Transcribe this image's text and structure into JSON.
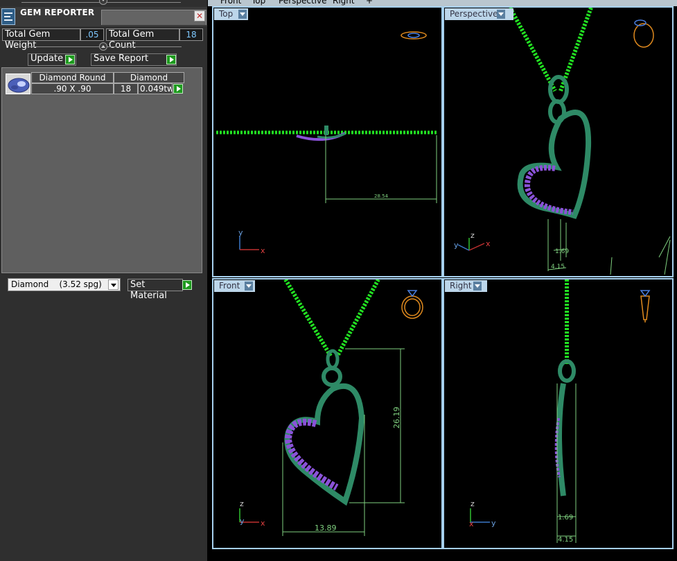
{
  "panel": {
    "title": "GEM REPORTER",
    "close_glyph": "✕",
    "total_gem_weight_label": "Total Gem Weight",
    "total_gem_weight_value": ".05",
    "total_gem_count_label": "Total Gem Count",
    "total_gem_count_value": "18",
    "update_label": "Update",
    "save_report_label": "Save Report",
    "gem_row": {
      "shape_header": "Diamond Round",
      "material_header": "Diamond",
      "size": ".90 X .90",
      "count": "18",
      "weight": "0.049tw"
    },
    "material_select_value": "Diamond    (3.52 spg)",
    "set_material_label": "Set Material"
  },
  "tabs": [
    "Front",
    "Top",
    "Perspective",
    "Right",
    "+"
  ],
  "viewports": {
    "top": {
      "label": "Top",
      "dimension": "28.54",
      "axes": [
        "y",
        "x"
      ]
    },
    "perspective": {
      "label": "Perspective",
      "dimensions": [
        "1.69",
        "4.15"
      ],
      "axes": [
        "z",
        "y",
        "x"
      ]
    },
    "front": {
      "label": "Front",
      "dimensions": [
        "26.19",
        "13.89"
      ],
      "axes": [
        "z",
        "y",
        "x"
      ]
    },
    "right": {
      "label": "Right",
      "dimensions": [
        "1.69",
        "4.15"
      ],
      "axes": [
        "z",
        "x",
        "y"
      ]
    }
  },
  "colors": {
    "chain": "#22e022",
    "metal": "#2e8a66",
    "gems": "#8a52d8",
    "dimension": "#7fd07f",
    "viewport_border": "#a6d0ee",
    "ring_icon": "#e08a1e"
  }
}
